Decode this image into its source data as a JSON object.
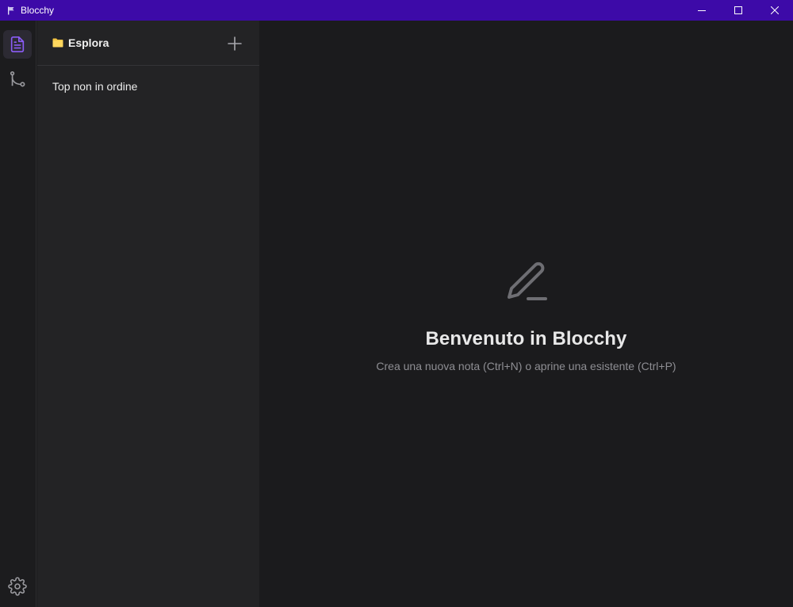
{
  "window": {
    "title": "Blocchy",
    "controls": [
      "minimize-icon",
      "maximize-icon",
      "close-icon"
    ]
  },
  "activitybar": {
    "items": [
      {
        "name": "notes",
        "icon": "document-icon",
        "active": true
      },
      {
        "name": "graph",
        "icon": "git-branch-icon",
        "active": false
      }
    ],
    "bottom": {
      "name": "settings",
      "icon": "gear-icon"
    }
  },
  "sidebar": {
    "title": "Esplora",
    "folder_icon": "folder-icon",
    "add_icon": "plus-icon",
    "notes": [
      "Top non in ordine"
    ]
  },
  "main": {
    "icon": "pencil-icon",
    "title": "Benvenuto in Blocchy",
    "subtitle": "Crea una nuova nota (Ctrl+N) o aprine una esistente (Ctrl+P)"
  },
  "colors": {
    "titlebar": "#3d0aa8",
    "accent": "#8b5cf6",
    "background": "#1b1b1d",
    "sidebar": "#232325"
  }
}
